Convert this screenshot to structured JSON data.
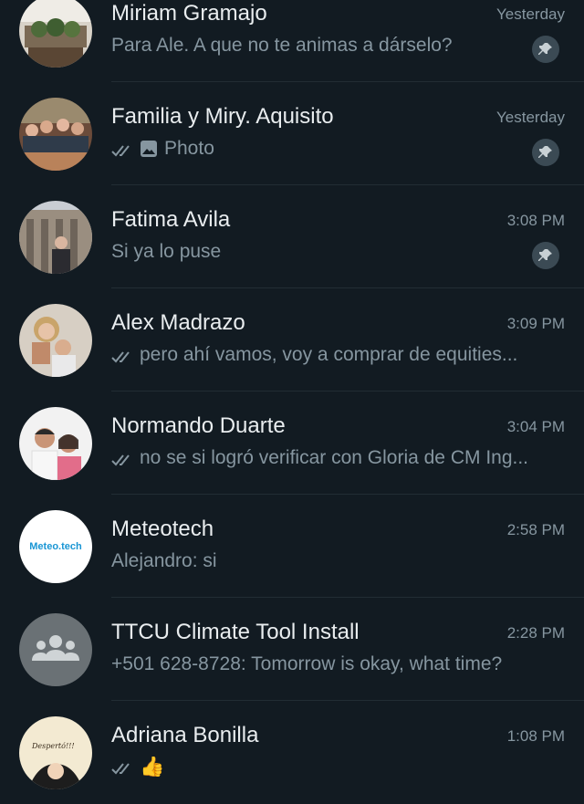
{
  "chats": [
    {
      "name": "Miriam Gramajo",
      "time": "Yesterday",
      "preview": "Para Ale. A que no te animas a dárselo?",
      "pinned": true,
      "ticks": false,
      "avatar": "photo-plants"
    },
    {
      "name": "Familia y Miry.  Aquisito",
      "time": "Yesterday",
      "preview": "Photo",
      "pinned": true,
      "ticks": true,
      "photo": true,
      "avatar": "photo-group-dinner"
    },
    {
      "name": "Fatima Avila",
      "time": "3:08 PM",
      "preview": "Si ya lo puse",
      "pinned": true,
      "ticks": false,
      "avatar": "photo-aqueduct"
    },
    {
      "name": "Alex Madrazo",
      "time": "3:09 PM",
      "preview": "pero ahí vamos, voy a comprar de equities...",
      "ticks": true,
      "avatar": "photo-couple"
    },
    {
      "name": "Normando Duarte",
      "time": "3:04 PM",
      "preview": "no se si logró verificar con Gloria de CM Ing...",
      "ticks": true,
      "avatar": "photo-couple-selfie"
    },
    {
      "name": "Meteotech",
      "time": "2:58 PM",
      "preview": "Alejandro: si",
      "ticks": false,
      "avatar_text": "Meteo.tech"
    },
    {
      "name": "TTCU Climate Tool Install",
      "time": "2:28 PM",
      "preview": "+501 628-8728: Tomorrow is okay, what time?",
      "ticks": false,
      "avatar": "group-icon"
    },
    {
      "name": "Adriana Bonilla",
      "time": "1:08 PM",
      "preview": "👍",
      "ticks": true,
      "avatar": "photo-cartoon",
      "avatar_text": "Despertó!!!"
    }
  ]
}
